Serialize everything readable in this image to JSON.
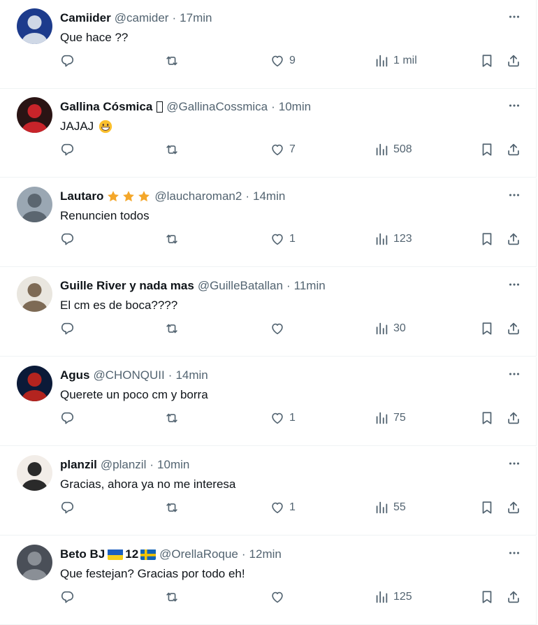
{
  "tweets": [
    {
      "name": "Camiider",
      "handle": "@camider",
      "time": "17min",
      "text": "Que hace ??",
      "likes": "9",
      "views": "1 mil",
      "badge": "none",
      "colors": [
        "#1d3b8c",
        "#cfd8e6"
      ]
    },
    {
      "name": "Gallina Cósmica",
      "handle": "@GallinaCossmica",
      "time": "10min",
      "text": "JAJAJ",
      "likes": "7",
      "views": "508",
      "badge": "box",
      "emoji": "grin",
      "colors": [
        "#2a1414",
        "#c8242a"
      ]
    },
    {
      "name": "Lautaro",
      "handle": "@laucharoman2",
      "time": "14min",
      "text": "Renuncien todos",
      "likes": "1",
      "views": "123",
      "badge": "stars",
      "colors": [
        "#9aa7b3",
        "#5b6670"
      ]
    },
    {
      "name": "Guille River y nada mas",
      "handle": "@GuilleBatallan",
      "time": "11min",
      "text": "El cm es de boca????",
      "likes": "",
      "views": "30",
      "badge": "none",
      "colors": [
        "#e9e6df",
        "#7d6a55"
      ]
    },
    {
      "name": "Agus",
      "handle": "@CHONQUII",
      "time": "14min",
      "text": "Querete un poco cm y borra",
      "likes": "1",
      "views": "75",
      "badge": "none",
      "colors": [
        "#0b1a38",
        "#b3241f"
      ]
    },
    {
      "name": "planzil",
      "handle": "@planzil",
      "time": "10min",
      "text": "Gracias, ahora ya no me interesa",
      "likes": "1",
      "views": "55",
      "badge": "none",
      "colors": [
        "#f2ede8",
        "#2a2a2a"
      ]
    },
    {
      "name": "Beto BJ",
      "handle": "@OrellaRoque",
      "time": "12min",
      "text": "Que festejan? Gracias por todo eh!",
      "likes": "",
      "views": "125",
      "badge": "flags",
      "badge_text": "12",
      "colors": [
        "#4a4f58",
        "#8a8f96"
      ]
    }
  ],
  "icons": {
    "reply": "reply-icon",
    "retweet": "retweet-icon",
    "like": "heart-icon",
    "views": "views-icon",
    "bookmark": "bookmark-icon",
    "share": "share-icon",
    "more": "more-icon"
  },
  "colors": {
    "text": "#0f1419",
    "muted": "#536471",
    "border": "#eff3f4",
    "star": "#f4a72a",
    "ua_blue": "#1c5fbf",
    "ua_yellow": "#f5cf1d",
    "se_blue": "#1465b5",
    "se_yellow": "#f7c600"
  }
}
